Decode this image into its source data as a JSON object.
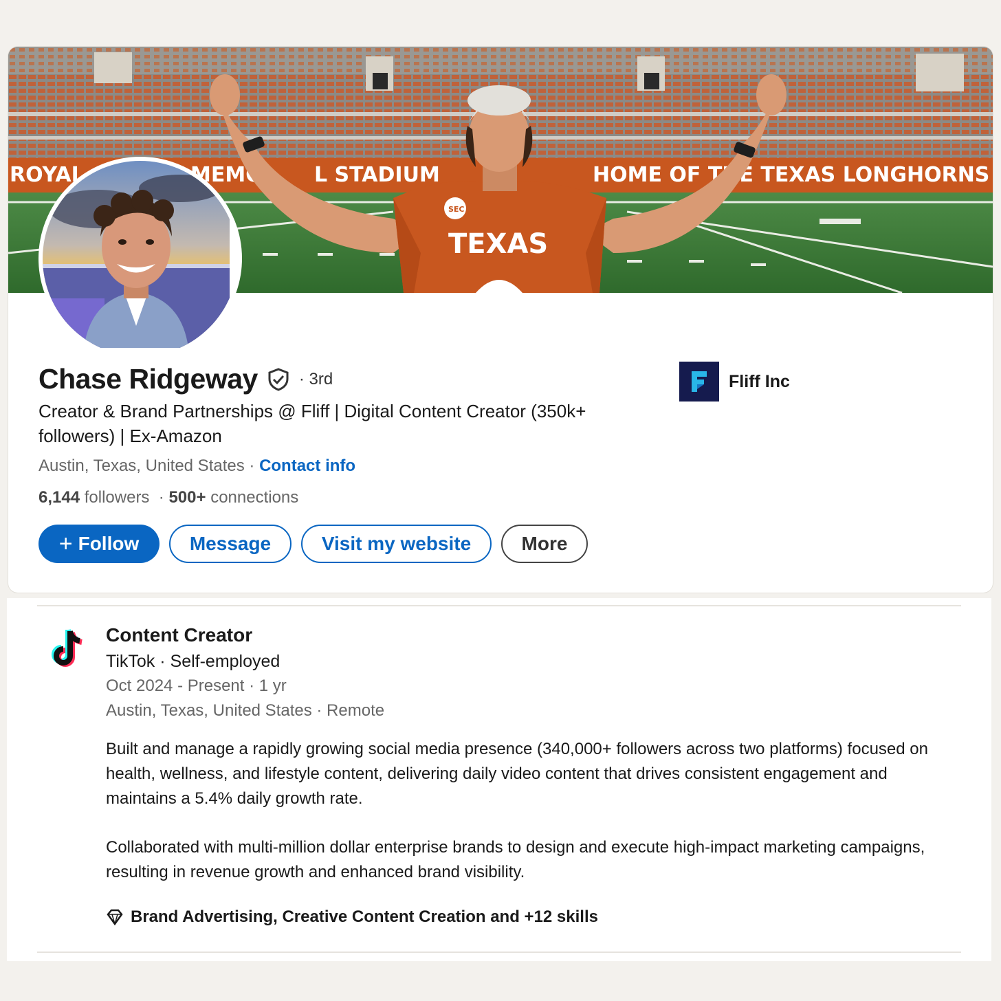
{
  "profile": {
    "name": "Chase Ridgeway",
    "degree": "· 3rd",
    "headline": "Creator & Brand Partnerships @ Fliff | Digital Content Creator (350k+ followers) | Ex-Amazon",
    "location": "Austin, Texas, United States ·",
    "contact_label": "Contact info",
    "followers_count": "6,144",
    "followers_label": "followers",
    "connections_count": "500+",
    "connections_label": "connections",
    "connections_sep": "·",
    "banner_text_left": "ROYAL",
    "banner_text_mid": "MEMO",
    "banner_text_stadium": "L STADIUM",
    "banner_text_right": "HOME OF THE TEXAS LONGHORNS",
    "jersey_text": "TEXAS",
    "jersey_patch": "SEC"
  },
  "actions": {
    "follow_label": "Follow",
    "follow_icon": "+",
    "message_label": "Message",
    "website_label": "Visit my website",
    "more_label": "More"
  },
  "company": {
    "name": "Fliff Inc",
    "logo_color": "#151b4e"
  },
  "experience": {
    "title": "Content Creator",
    "company": "TikTok · Self-employed",
    "dates": "Oct 2024 - Present · 1 yr",
    "location": "Austin, Texas, United States · Remote",
    "description_1": "Built and manage a rapidly growing social media presence (340,000+ followers across two platforms) focused on health, wellness, and lifestyle content, delivering daily video content that drives consistent engagement and maintains a 5.4% daily growth rate.",
    "description_2": "Collaborated with multi-million dollar enterprise brands to design and execute high-impact marketing campaigns, resulting in revenue growth and enhanced brand visibility.",
    "skills": "Brand Advertising, Creative Content Creation and +12 skills"
  },
  "colors": {
    "accent": "#0a66c2",
    "texas_orange": "#c8571f",
    "field_green": "#3f7a3a"
  }
}
